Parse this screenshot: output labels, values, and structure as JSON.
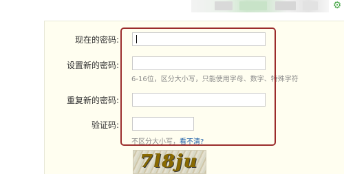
{
  "form": {
    "current_password": {
      "label": "现在的密码:"
    },
    "new_password": {
      "label": "设置新的密码:",
      "hint": "6-16位，区分大小写，只能使用字母、数字、特殊字符"
    },
    "repeat_password": {
      "label": "重复新的密码:"
    },
    "captcha": {
      "label": "验证码:",
      "hint": "不区分大小写，",
      "refresh_link": "看不清?",
      "image_text": "7l8ju"
    }
  },
  "colors": {
    "panel_bg": "#fffef0",
    "highlight_border": "#9b2c2c",
    "link": "#1d5fa8",
    "gear": "#4aa84a"
  },
  "icons": {
    "top_right": "gear-icon"
  }
}
